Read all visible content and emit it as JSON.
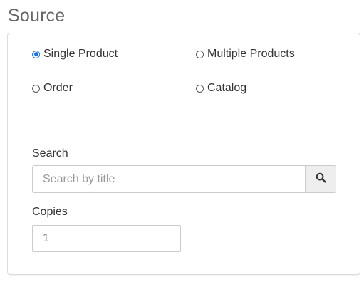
{
  "title": "Source",
  "source_options": {
    "single_product": {
      "label": "Single Product",
      "checked": true
    },
    "multiple_products": {
      "label": "Multiple Products",
      "checked": false
    },
    "order": {
      "label": "Order",
      "checked": false
    },
    "catalog": {
      "label": "Catalog",
      "checked": false
    }
  },
  "search": {
    "label": "Search",
    "placeholder": "Search by title",
    "value": ""
  },
  "copies": {
    "label": "Copies",
    "value": "1"
  },
  "colors": {
    "radio_accent": "#1a73e8",
    "border": "#cccccc",
    "button_bg": "#eeeeee"
  },
  "icons": {
    "search_button": "search-icon"
  }
}
